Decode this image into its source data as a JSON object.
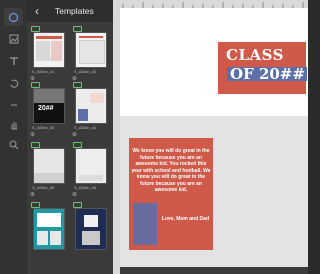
{
  "panel": {
    "back_icon": "chevron-left-icon",
    "title": "Templates",
    "items": [
      {
        "caption": "S_ADkin_01"
      },
      {
        "caption": "S_ADkin_02"
      },
      {
        "caption": "S_ADkin_03"
      },
      {
        "caption": "S_ADkin_04"
      },
      {
        "caption": "S_ADkin_05"
      },
      {
        "caption": "S_ADkin_06"
      },
      {
        "caption": ""
      },
      {
        "caption": ""
      }
    ],
    "thumb_text": "20##"
  },
  "tools": [
    "cursor-icon",
    "image-icon",
    "text-icon",
    "undo-icon",
    "hand-icon",
    "zoom-icon"
  ],
  "canvas": {
    "title_line1": "CLASS",
    "title_line2": "OF 20##",
    "message": "We know you will do great in the future because you are an awesome kid. You rocked this year with school and football. We know you will do great in the future because you are an awesome kid.",
    "signature": "Love, Mom and Dad"
  },
  "colors": {
    "accent_red": "#cf5a4a",
    "accent_blue": "#5c6fa8",
    "panel_bg": "#3a3a3a"
  }
}
